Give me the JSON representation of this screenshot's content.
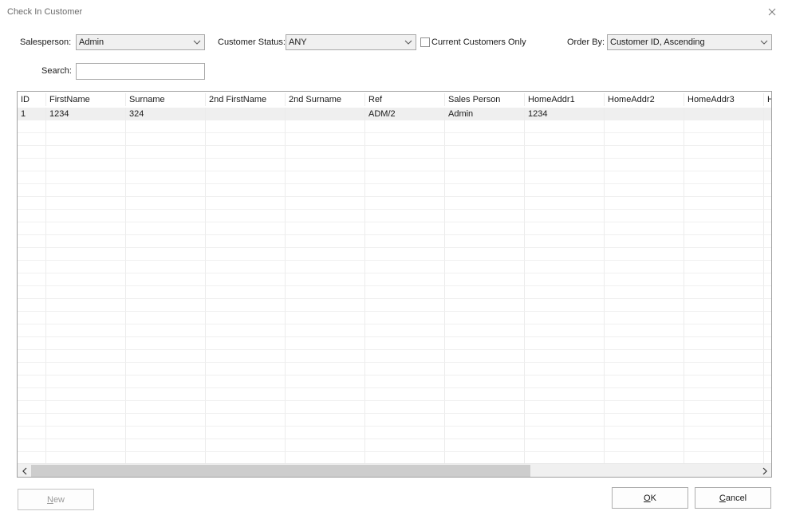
{
  "window": {
    "title": "Check In Customer"
  },
  "filters": {
    "salesperson_label": "Salesperson:",
    "salesperson_value": "Admin",
    "status_label": "Customer Status:",
    "status_value": "ANY",
    "current_only_label": "Current Customers Only",
    "current_only_checked": false,
    "order_label": "Order By:",
    "order_value": "Customer ID, Ascending",
    "search_label": "Search:",
    "search_value": ""
  },
  "grid": {
    "columns": [
      "ID",
      "FirstName",
      "Surname",
      "2nd FirstName",
      "2nd Surname",
      "Ref",
      "Sales Person",
      "HomeAddr1",
      "HomeAddr2",
      "HomeAddr3",
      "H"
    ],
    "rows": [
      [
        "1",
        "1234",
        "324",
        "",
        "",
        "ADM/2",
        "Admin",
        "1234",
        "",
        "",
        ""
      ]
    ]
  },
  "buttons": {
    "new_mnemonic": "N",
    "new_rest": "ew",
    "ok_mnemonic": "O",
    "ok_rest": "K",
    "cancel_mnemonic": "C",
    "cancel_rest": "ancel"
  },
  "icons": {
    "close": "close-icon",
    "dropdown": "chevron-down-icon",
    "scroll_left": "chevron-left-icon",
    "scroll_right": "chevron-right-icon"
  }
}
